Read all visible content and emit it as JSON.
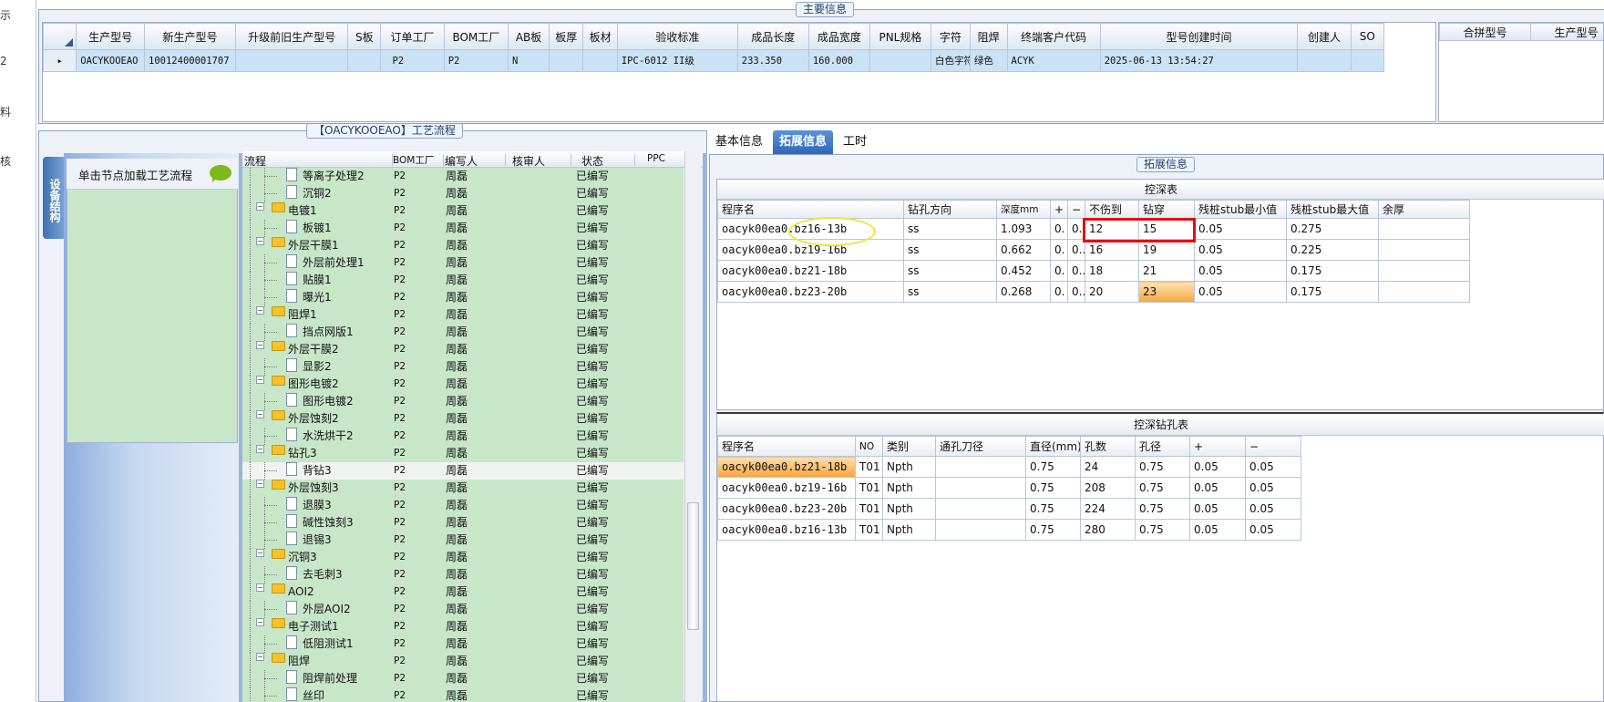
{
  "left_nav": {
    "items": [
      "示",
      "2",
      "料",
      "核"
    ]
  },
  "main_info": {
    "title": "主要信息",
    "columns": [
      "生产型号",
      "新生产型号",
      "升级前旧生产型号",
      "S板",
      "订单工厂",
      "BOM工厂",
      "AB板",
      "板厚",
      "板材",
      "验收标准",
      "成品长度",
      "成品宽度",
      "PNL规格",
      "字符",
      "阻焊",
      "终端客户代码",
      "型号创建时间",
      "创建人",
      "SO"
    ],
    "row": [
      "OACYKOOEAO",
      "10012400001707",
      "",
      "",
      "P2",
      "P2",
      "N",
      "",
      "",
      "IPC-6012 II级",
      "233.350",
      "160.000",
      "",
      "白色字符",
      "绿色",
      "ACYK",
      "2025-06-13 13:54:27",
      "",
      ""
    ],
    "row_marker": "▸",
    "combine_columns": [
      "合拼型号",
      "生产型号"
    ]
  },
  "process": {
    "title": "【OACYKOOEAO】工艺流程",
    "vertical_tab": "设备结构",
    "hint": "单击节点加载工艺流程",
    "columns": [
      "流程",
      "BOM工厂",
      "编写人",
      "核审人",
      "状态",
      "PPC"
    ],
    "rows": [
      {
        "name": "等离子处理2",
        "bom": "P2",
        "writer": "周磊",
        "reviewer": "",
        "status": "已编写",
        "folder": false
      },
      {
        "name": "沉铜2",
        "bom": "P2",
        "writer": "周磊",
        "reviewer": "",
        "status": "已编写",
        "folder": false
      },
      {
        "name": "电镀1",
        "bom": "P2",
        "writer": "周磊",
        "reviewer": "",
        "status": "已编写",
        "folder": true
      },
      {
        "name": "板镀1",
        "bom": "P2",
        "writer": "周磊",
        "reviewer": "",
        "status": "已编写",
        "folder": false
      },
      {
        "name": "外层干膜1",
        "bom": "P2",
        "writer": "周磊",
        "reviewer": "",
        "status": "已编写",
        "folder": true
      },
      {
        "name": "外层前处理1",
        "bom": "P2",
        "writer": "周磊",
        "reviewer": "",
        "status": "已编写",
        "folder": false
      },
      {
        "name": "贴膜1",
        "bom": "P2",
        "writer": "周磊",
        "reviewer": "",
        "status": "已编写",
        "folder": false
      },
      {
        "name": "曝光1",
        "bom": "P2",
        "writer": "周磊",
        "reviewer": "",
        "status": "已编写",
        "folder": false
      },
      {
        "name": "阻焊1",
        "bom": "P2",
        "writer": "周磊",
        "reviewer": "",
        "status": "已编写",
        "folder": true
      },
      {
        "name": "挡点网版1",
        "bom": "P2",
        "writer": "周磊",
        "reviewer": "",
        "status": "已编写",
        "folder": false
      },
      {
        "name": "外层干膜2",
        "bom": "P2",
        "writer": "周磊",
        "reviewer": "",
        "status": "已编写",
        "folder": true
      },
      {
        "name": "显影2",
        "bom": "P2",
        "writer": "周磊",
        "reviewer": "",
        "status": "已编写",
        "folder": false
      },
      {
        "name": "图形电镀2",
        "bom": "P2",
        "writer": "周磊",
        "reviewer": "",
        "status": "已编写",
        "folder": true
      },
      {
        "name": "图形电镀2",
        "bom": "P2",
        "writer": "周磊",
        "reviewer": "",
        "status": "已编写",
        "folder": false
      },
      {
        "name": "外层蚀刻2",
        "bom": "P2",
        "writer": "周磊",
        "reviewer": "",
        "status": "已编写",
        "folder": true
      },
      {
        "name": "水洗烘干2",
        "bom": "P2",
        "writer": "周磊",
        "reviewer": "",
        "status": "已编写",
        "folder": false
      },
      {
        "name": "钻孔3",
        "bom": "P2",
        "writer": "周磊",
        "reviewer": "",
        "status": "已编写",
        "folder": true
      },
      {
        "name": "背钻3",
        "bom": "P2",
        "writer": "周磊",
        "reviewer": "",
        "status": "已编写",
        "folder": false,
        "selected": true
      },
      {
        "name": "外层蚀刻3",
        "bom": "P2",
        "writer": "周磊",
        "reviewer": "",
        "status": "已编写",
        "folder": true
      },
      {
        "name": "退膜3",
        "bom": "P2",
        "writer": "周磊",
        "reviewer": "",
        "status": "已编写",
        "folder": false
      },
      {
        "name": "碱性蚀刻3",
        "bom": "P2",
        "writer": "周磊",
        "reviewer": "",
        "status": "已编写",
        "folder": false
      },
      {
        "name": "退锡3",
        "bom": "P2",
        "writer": "周磊",
        "reviewer": "",
        "status": "已编写",
        "folder": false
      },
      {
        "name": "沉铜3",
        "bom": "P2",
        "writer": "周磊",
        "reviewer": "",
        "status": "已编写",
        "folder": true
      },
      {
        "name": "去毛刺3",
        "bom": "P2",
        "writer": "周磊",
        "reviewer": "",
        "status": "已编写",
        "folder": false
      },
      {
        "name": "AOI2",
        "bom": "P2",
        "writer": "周磊",
        "reviewer": "",
        "status": "已编写",
        "folder": true
      },
      {
        "name": "外层AOI2",
        "bom": "P2",
        "writer": "周磊",
        "reviewer": "",
        "status": "已编写",
        "folder": false
      },
      {
        "name": "电子测试1",
        "bom": "P2",
        "writer": "周磊",
        "reviewer": "",
        "status": "已编写",
        "folder": true
      },
      {
        "name": "低阻测试1",
        "bom": "P2",
        "writer": "周磊",
        "reviewer": "",
        "status": "已编写",
        "folder": false
      },
      {
        "name": "阻焊",
        "bom": "P2",
        "writer": "周磊",
        "reviewer": "",
        "status": "已编写",
        "folder": true
      },
      {
        "name": "阻焊前处理",
        "bom": "P2",
        "writer": "周磊",
        "reviewer": "",
        "status": "已编写",
        "folder": false
      },
      {
        "name": "丝印",
        "bom": "P2",
        "writer": "周磊",
        "reviewer": "",
        "status": "已编写",
        "folder": false
      }
    ]
  },
  "tabs": {
    "basic": "基本信息",
    "extended": "拓展信息",
    "hours": "工时"
  },
  "extended": {
    "title": "拓展信息",
    "deep_table": {
      "caption": "控深表",
      "columns": [
        "程序名",
        "钻孔方向",
        "深度mm",
        "+",
        "−",
        "不伤到",
        "钻穿",
        "残桩stub最小值",
        "残桩stub最大值",
        "余厚"
      ],
      "rows": [
        [
          "oacyk00ea0.bz16-13b",
          "ss",
          "1.093",
          "0.",
          "0..",
          "12",
          "15",
          "0.05",
          "0.275",
          ""
        ],
        [
          "oacyk00ea0.bz19-16b",
          "ss",
          "0.662",
          "0.",
          "0..",
          "16",
          "19",
          "0.05",
          "0.225",
          ""
        ],
        [
          "oacyk00ea0.bz21-18b",
          "ss",
          "0.452",
          "0.",
          "0..",
          "18",
          "21",
          "0.05",
          "0.175",
          ""
        ],
        [
          "oacyk00ea0.bz23-20b",
          "ss",
          "0.268",
          "0.",
          "0..",
          "20",
          "23",
          "0.05",
          "0.175",
          ""
        ]
      ]
    },
    "drill_table": {
      "caption": "控深钻孔表",
      "columns": [
        "程序名",
        "NO",
        "类别",
        "通孔刀径",
        "直径(mm)",
        "孔数",
        "孔径",
        "+",
        "−"
      ],
      "rows": [
        [
          "oacyk00ea0.bz21-18b",
          "T01",
          "Npth",
          "",
          "0.75",
          "24",
          "0.75",
          "0.05",
          "0.05"
        ],
        [
          "oacyk00ea0.bz19-16b",
          "T01",
          "Npth",
          "",
          "0.75",
          "208",
          "0.75",
          "0.05",
          "0.05"
        ],
        [
          "oacyk00ea0.bz23-20b",
          "T01",
          "Npth",
          "",
          "0.75",
          "224",
          "0.75",
          "0.05",
          "0.05"
        ],
        [
          "oacyk00ea0.bz16-13b",
          "T01",
          "Npth",
          "",
          "0.75",
          "280",
          "0.75",
          "0.05",
          "0.05"
        ]
      ]
    }
  },
  "colors": {
    "accent": "#2d68b8",
    "highlight_red": "#e01010",
    "annotation_yellow": "#f2e23a",
    "tree_bg": "#c8e7c9",
    "row_select": "#cbe1f6"
  },
  "icons": {
    "folder": "folder-icon",
    "document": "document-icon",
    "chat": "speech-bubble-icon"
  }
}
